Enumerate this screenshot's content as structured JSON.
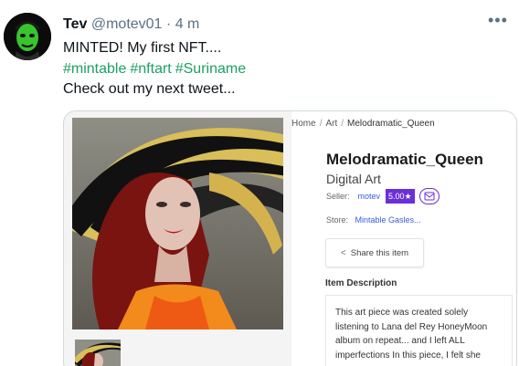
{
  "tweet": {
    "display_name": "Tev",
    "handle": "@motev01",
    "separator": "·",
    "time": "4 m",
    "more_icon": "ellipsis-icon",
    "lines": [
      "MINTED! My first NFT....",
      "Check out my next tweet..."
    ],
    "hashtags": [
      "#mintable",
      "#nftart",
      "#Suriname"
    ],
    "hashtag_color": "#1da064"
  },
  "card": {
    "breadcrumb": [
      "Home",
      "Art",
      "Melodramatic_Queen"
    ],
    "breadcrumb_separator": "/",
    "title": "Melodramatic_Queen",
    "category": "Digital Art",
    "seller_label": "Seller:",
    "seller_name": "motev",
    "seller_score": "5.00★",
    "store_label": "Store:",
    "store_name": "Mintable Gasles...",
    "share_label": "Share this item",
    "description_label": "Item Description",
    "description": "This art piece was created solely listening to Lana del Rey HoneyMoon album on repeat... and I left ALL imperfections In this piece, I felt she",
    "accent_color": "#6a2fd6",
    "link_color": "#3b5bdb"
  }
}
